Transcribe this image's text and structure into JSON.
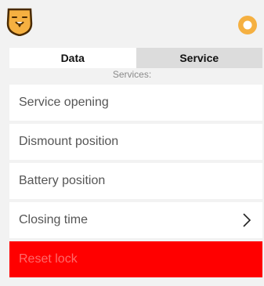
{
  "tabs": [
    {
      "label": "Data",
      "active": true
    },
    {
      "label": "Service",
      "active": false
    }
  ],
  "section_label": "Services:",
  "services": [
    {
      "label": "Service opening"
    },
    {
      "label": "Dismount position"
    },
    {
      "label": "Battery position"
    },
    {
      "label": "Closing time",
      "icon": "chevron-right-icon"
    },
    {
      "label": "Reset lock",
      "danger": true
    }
  ],
  "colors": {
    "accent": "#f5b041",
    "danger": "#ff0000",
    "danger_text": "#ff6a6a"
  },
  "icons": {
    "logo": "lion-logo-icon",
    "status": "status-ring-icon"
  }
}
